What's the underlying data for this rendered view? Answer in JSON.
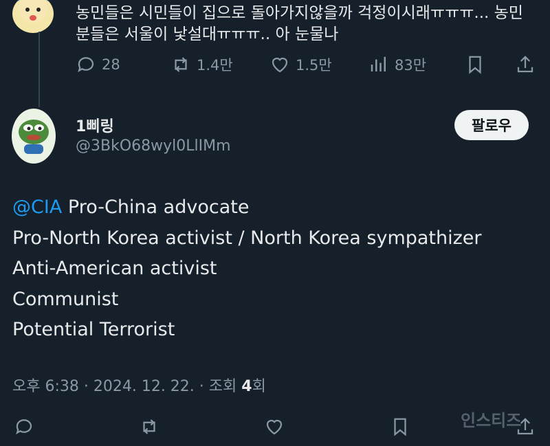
{
  "previous_reply": {
    "text": "농민들은 시민들이 집으로 돌아가지않을까 걱정이시래ㅠㅠㅠ... 농민분들은 서울이 낯설대ㅠㅠㅠ.. 아 눈물나",
    "replies": "28",
    "reposts": "1.4만",
    "likes": "1.5만",
    "views": "83만"
  },
  "tweet": {
    "display_name": "1삐링",
    "handle": "@3BkO68wyl0LlIMm",
    "follow_label": "팔로우",
    "mention": "@CIA",
    "lines": [
      "Pro-China advocate",
      "Pro-North Korea activist / North Korea sympathizer",
      "Anti-American activist",
      "Communist",
      "Potential Terrorist"
    ],
    "meta_prefix": "오후 6:38 · 2024. 12. 22. · 조회 ",
    "meta_count": "4",
    "meta_suffix": "회"
  },
  "watermark": "인스티즈",
  "colors": {
    "background": "#15202b",
    "accent": "#1d9bf0",
    "muted": "#8b98a5",
    "text": "#e7e9ea"
  }
}
